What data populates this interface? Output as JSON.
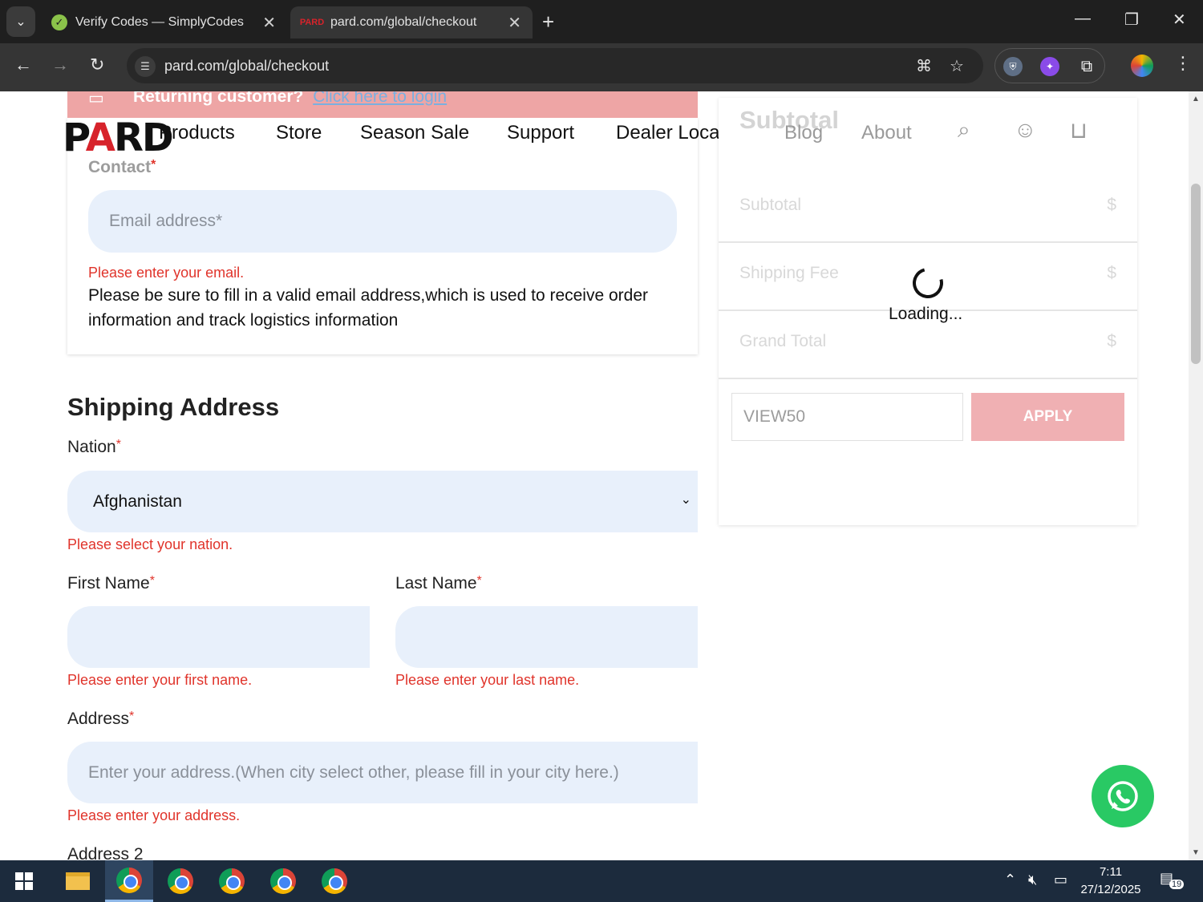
{
  "browser": {
    "tabs": [
      {
        "title": "Verify Codes — SimplyCodes",
        "active": false
      },
      {
        "title": "pard.com/global/checkout",
        "active": true
      }
    ],
    "url": "pard.com/global/checkout"
  },
  "site": {
    "logo": "PARD",
    "nav": [
      "Products",
      "Store",
      "Season Sale",
      "Support",
      "Dealer Locator",
      "Blog",
      "About"
    ],
    "login_prompt": "Returning customer?",
    "login_link": "Click here to login"
  },
  "contact": {
    "label": "Contact",
    "email_placeholder": "Email address*",
    "email_error": "Please enter your email.",
    "help": "Please be sure to fill in a valid email address,which is used to receive order information and track logistics information"
  },
  "shipping": {
    "heading": "Shipping Address",
    "nation_label": "Nation",
    "nation_value": "Afghanistan",
    "nation_error": "Please select your nation.",
    "first_name_label": "First Name",
    "first_name_error": "Please enter your first name.",
    "last_name_label": "Last Name",
    "last_name_error": "Please enter your last name.",
    "address_label": "Address",
    "address_placeholder": "Enter your address.(When city select other, please fill in your city here.)",
    "address_error": "Please enter your address.",
    "address2_label": "Address 2"
  },
  "summary": {
    "title": "Subtotal",
    "rows": [
      {
        "label": "Subtotal",
        "value": "$"
      },
      {
        "label": "Shipping Fee",
        "value": "$"
      },
      {
        "label": "Grand Total",
        "value": "$"
      }
    ],
    "coupon_value": "VIEW50",
    "apply_label": "APPLY",
    "loading_text": "Loading..."
  },
  "taskbar": {
    "time": "7:11",
    "date": "27/12/2025",
    "notifications": "19"
  },
  "colors": {
    "accent_pink": "#eea5a5",
    "error_red": "#e0342b",
    "field_bg": "#e8f0fb",
    "whatsapp_green": "#29c964"
  }
}
